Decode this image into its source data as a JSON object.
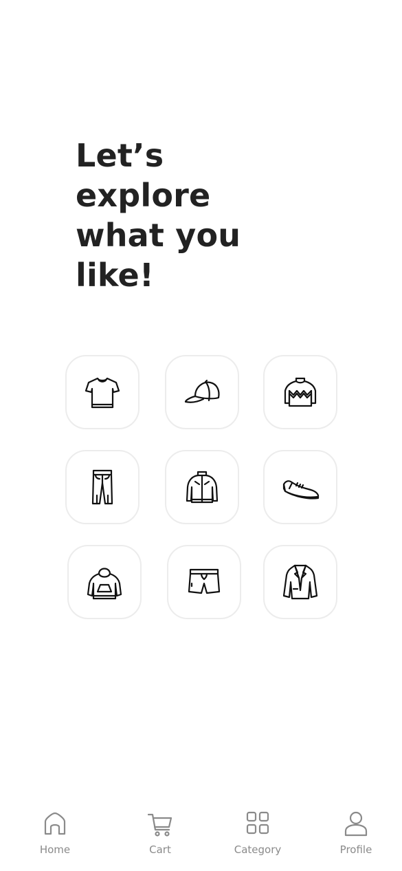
{
  "headline": {
    "line1": "Let’s",
    "line2": "explore",
    "line3": "what you",
    "line4": "like!"
  },
  "categories": [
    {
      "icon": "tshirt-icon"
    },
    {
      "icon": "cap-icon"
    },
    {
      "icon": "sweater-icon"
    },
    {
      "icon": "jeans-icon"
    },
    {
      "icon": "jacket-icon"
    },
    {
      "icon": "sneaker-icon"
    },
    {
      "icon": "hoodie-icon"
    },
    {
      "icon": "shorts-icon"
    },
    {
      "icon": "blazer-icon"
    }
  ],
  "bottom_nav": {
    "items": [
      {
        "label": "Home",
        "icon": "home-icon"
      },
      {
        "label": "Cart",
        "icon": "cart-icon"
      },
      {
        "label": "Category",
        "icon": "grid-icon"
      },
      {
        "label": "Profile",
        "icon": "user-icon"
      }
    ]
  },
  "colors": {
    "text": "#222222",
    "nav": "#8a8a8a",
    "tile_border": "#ececec",
    "background": "#ffffff"
  }
}
